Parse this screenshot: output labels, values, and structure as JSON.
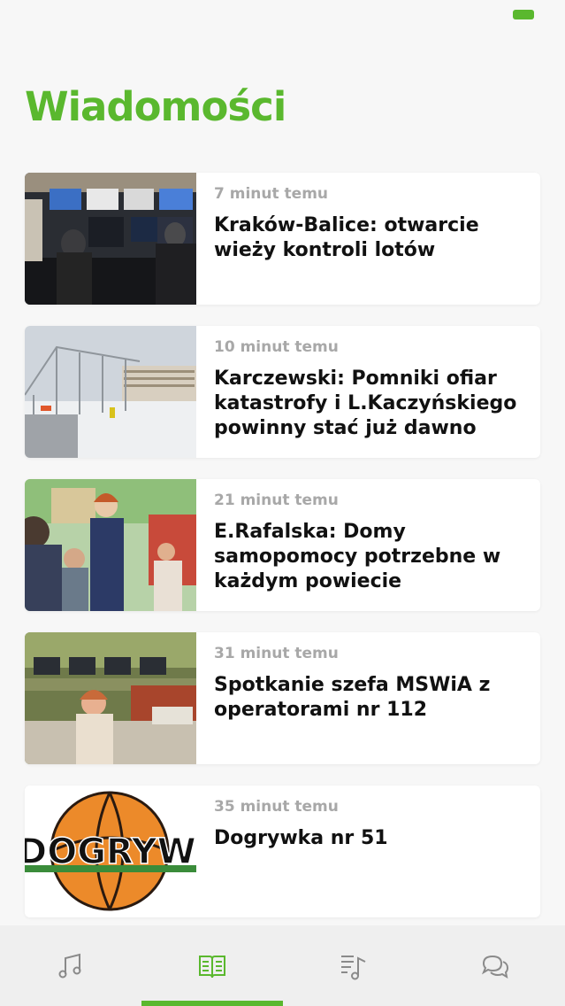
{
  "colors": {
    "accent": "#5ab82e",
    "icon_inactive": "#8a8a8a"
  },
  "header": {
    "title": "Wiadomości"
  },
  "news": [
    {
      "time": "7 minut temu",
      "headline": "Kraków-Balice: otwarcie wieży kontroli lotów"
    },
    {
      "time": "10 minut temu",
      "headline": "Karczewski: Pomniki ofiar katastrofy i L.Kaczyńskiego powinny stać już dawno"
    },
    {
      "time": "21 minut temu",
      "headline": "E.Rafalska: Domy samopomocy potrzebne w każdym powiecie"
    },
    {
      "time": "31 minut temu",
      "headline": "Spotkanie szefa MSWiA z operatorami nr 112"
    },
    {
      "time": "35 minut temu",
      "headline": "Dogrywka nr 51",
      "logo_text": "DOGRYWKA"
    }
  ],
  "tabs": [
    {
      "icon": "music-note-icon",
      "active": false
    },
    {
      "icon": "open-book-icon",
      "active": true
    },
    {
      "icon": "playlist-icon",
      "active": false
    },
    {
      "icon": "chat-bubbles-icon",
      "active": false
    }
  ]
}
